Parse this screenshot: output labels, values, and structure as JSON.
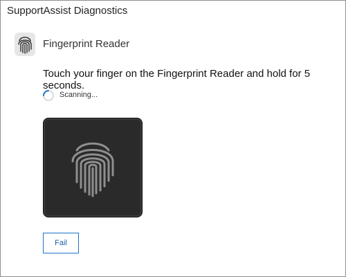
{
  "window": {
    "title": "SupportAssist Diagnostics"
  },
  "device": {
    "name": "Fingerprint Reader",
    "icon": "fingerprint-icon"
  },
  "instruction": "Touch your finger on the Fingerprint Reader and hold for 5 seconds.",
  "status": {
    "text": "Scanning...",
    "icon": "loading-spinner-icon",
    "accent_color": "#1a73c9"
  },
  "scan_pad": {
    "icon": "fingerprint-icon",
    "background_color": "#2a2a2a"
  },
  "actions": {
    "fail_label": "Fail"
  }
}
